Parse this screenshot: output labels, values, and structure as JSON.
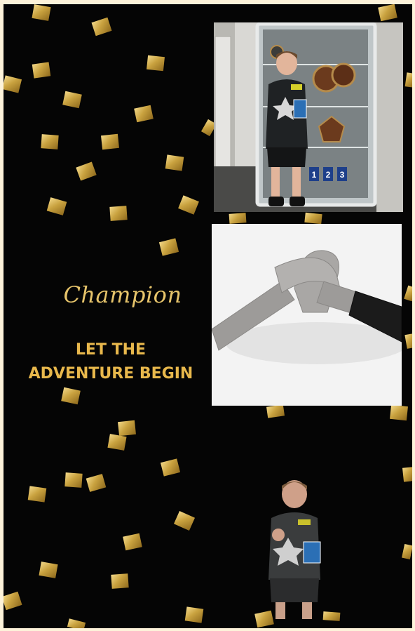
{
  "heading": {
    "script_title": "Champion"
  },
  "slogan": {
    "line1": "LET THE",
    "line2": "ADVENTURE BEGIN"
  },
  "colors": {
    "background": "#050505",
    "border": "#fdf3da",
    "gold_text": "#e8b84c",
    "belt_grey": "#9d9b99",
    "belt_black": "#1b1b1b"
  },
  "photos": {
    "trophy_cabinet": {
      "sticker_number_1": "1",
      "sticker_number_2": "2",
      "sticker_number_3": "3"
    },
    "belt": {},
    "cutout": {}
  }
}
